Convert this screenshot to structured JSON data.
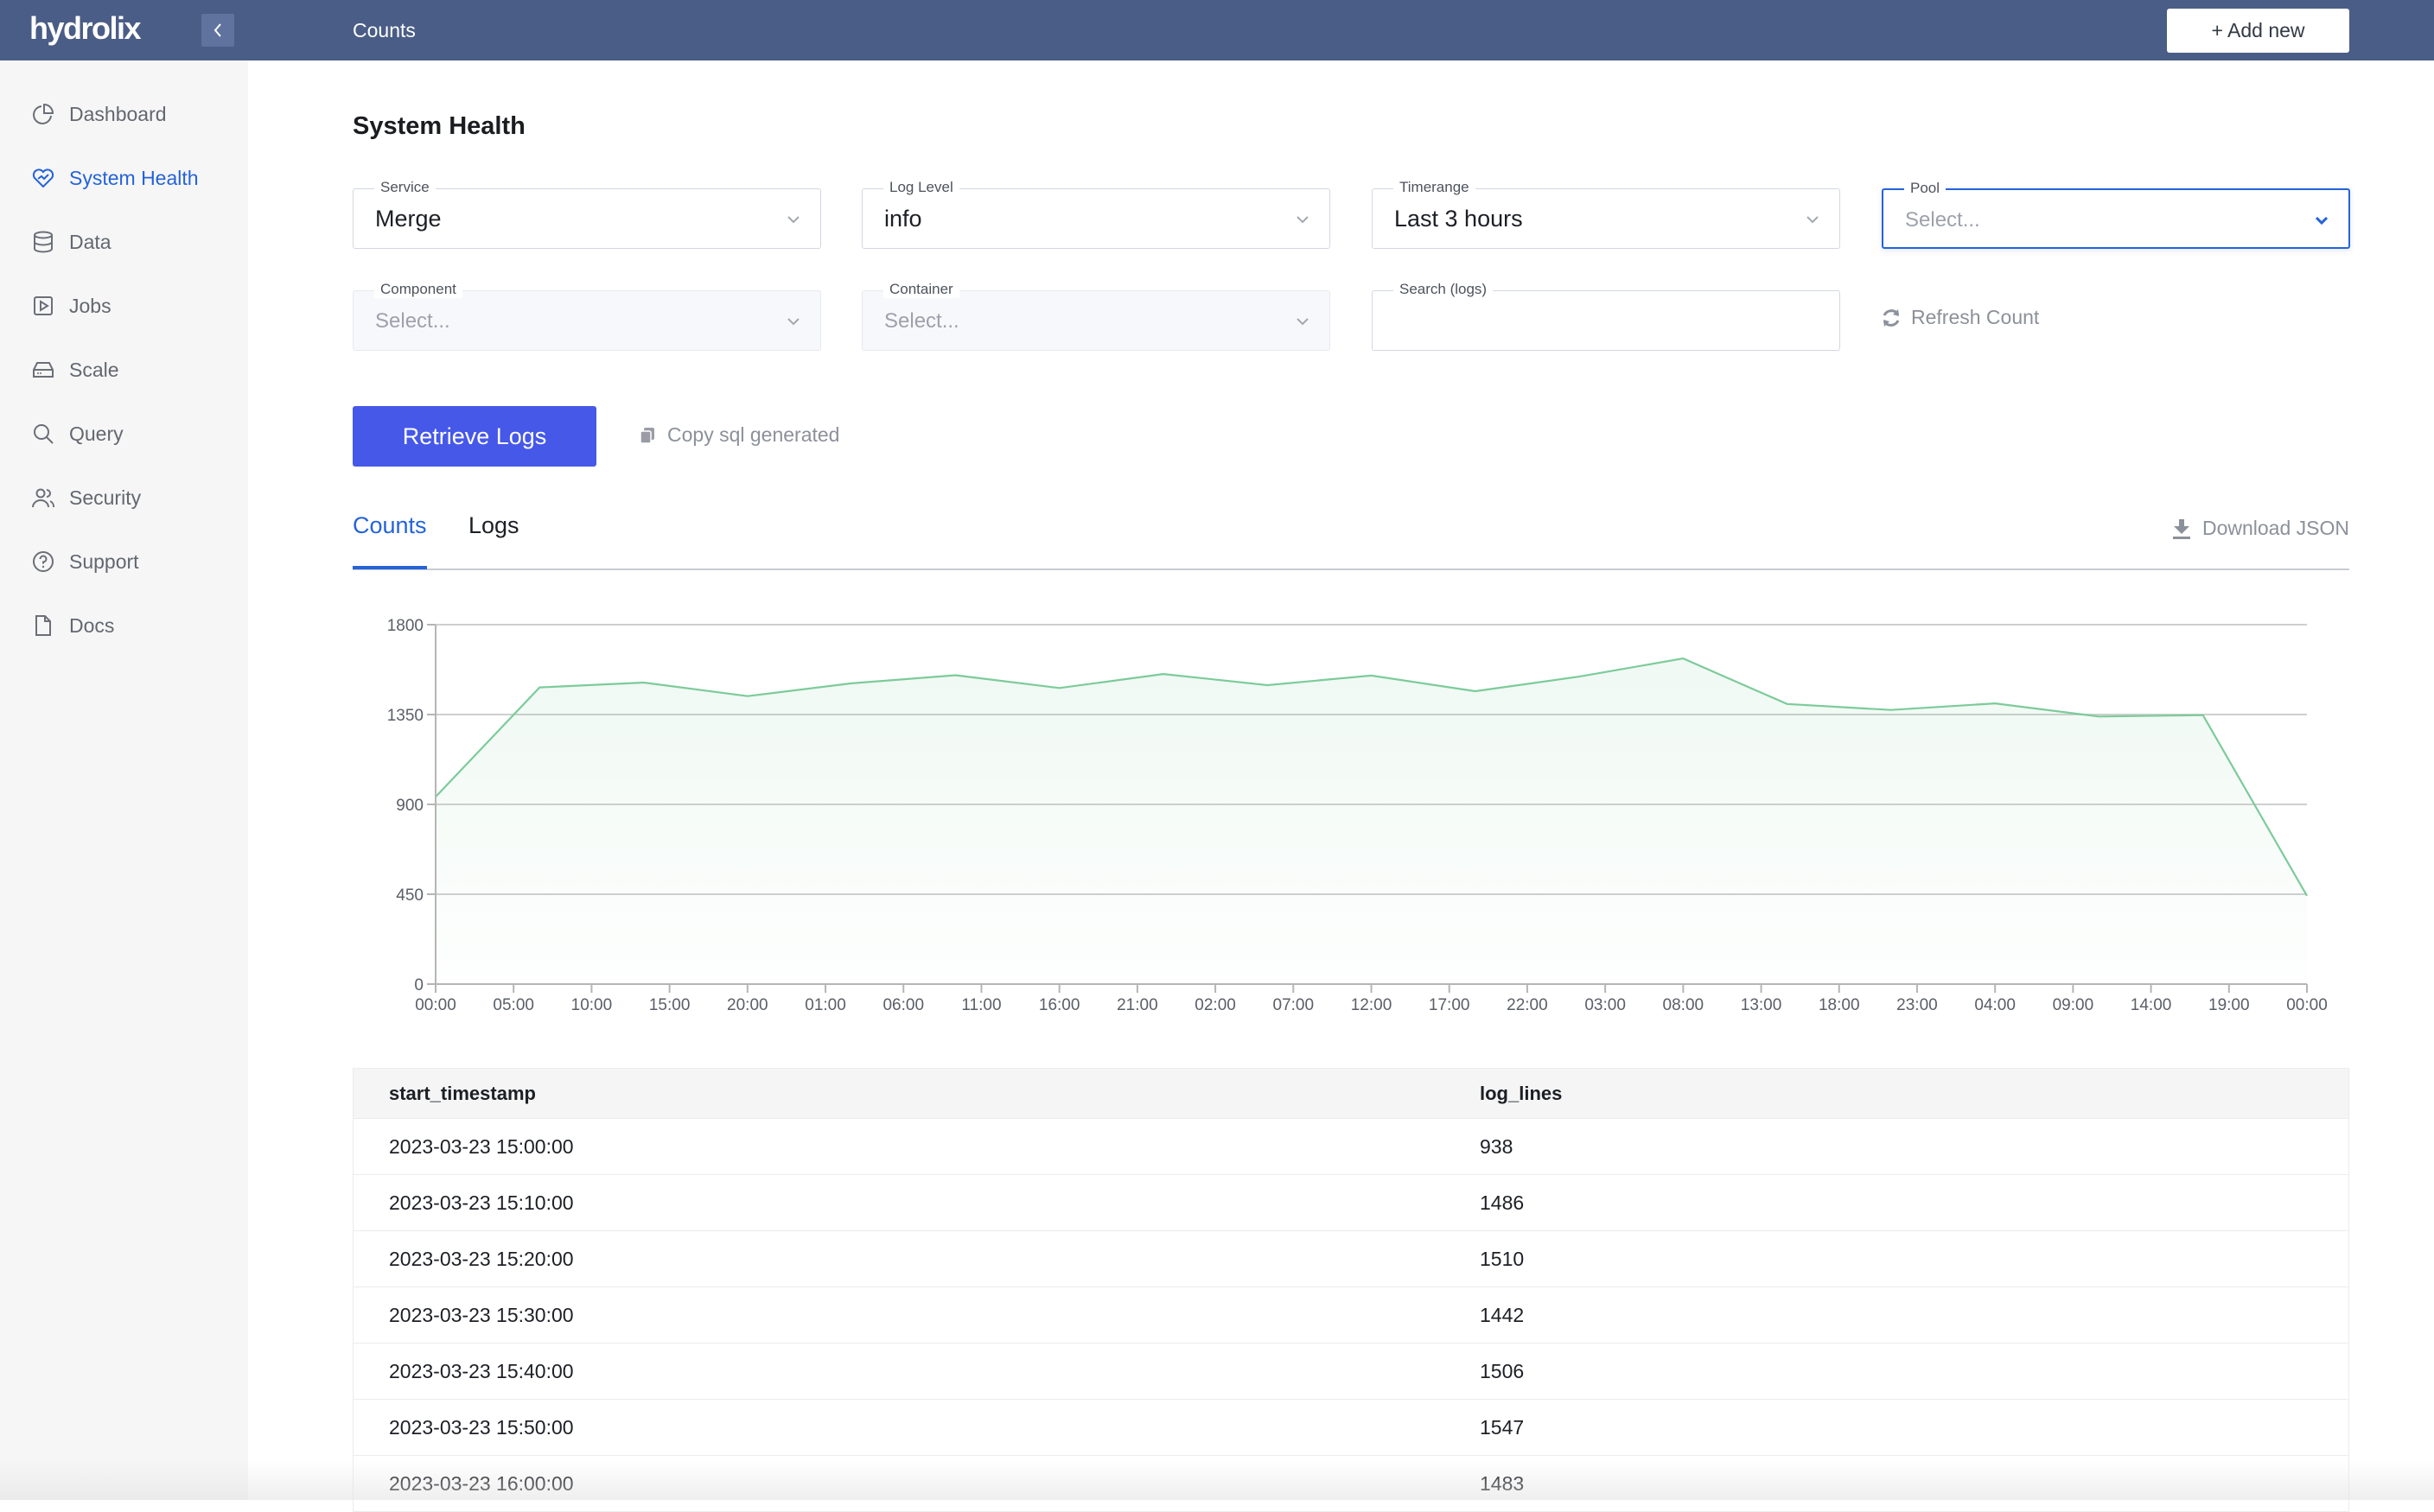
{
  "header": {
    "logo": "hydrolix",
    "title": "Counts",
    "add_new_label": "+ Add new",
    "collapse_icon": "chevron-left-icon"
  },
  "sidebar": {
    "items": [
      {
        "label": "Dashboard",
        "icon": "pie-chart-icon",
        "active": false
      },
      {
        "label": "System Health",
        "icon": "heart-pulse-icon",
        "active": true
      },
      {
        "label": "Data",
        "icon": "database-icon",
        "active": false
      },
      {
        "label": "Jobs",
        "icon": "play-box-icon",
        "active": false
      },
      {
        "label": "Scale",
        "icon": "server-drive-icon",
        "active": false
      },
      {
        "label": "Query",
        "icon": "search-icon",
        "active": false
      },
      {
        "label": "Security",
        "icon": "users-icon",
        "active": false
      },
      {
        "label": "Support",
        "icon": "help-circle-icon",
        "active": false
      },
      {
        "label": "Docs",
        "icon": "file-icon",
        "active": false
      }
    ]
  },
  "page": {
    "title": "System Health"
  },
  "filters": {
    "service": {
      "label": "Service",
      "value": "Merge"
    },
    "log_level": {
      "label": "Log Level",
      "value": "info"
    },
    "timerange": {
      "label": "Timerange",
      "value": "Last 3 hours"
    },
    "pool": {
      "label": "Pool",
      "placeholder": "Select..."
    },
    "component": {
      "label": "Component",
      "placeholder": "Select..."
    },
    "container": {
      "label": "Container",
      "placeholder": "Select..."
    },
    "search": {
      "label": "Search (logs)",
      "value": ""
    },
    "refresh_label": "Refresh Count"
  },
  "actions": {
    "retrieve_label": "Retrieve Logs",
    "copy_sql_label": "Copy sql generated"
  },
  "tabs": {
    "items": [
      {
        "label": "Counts",
        "active": true
      },
      {
        "label": "Logs",
        "active": false
      }
    ],
    "download_label": "Download JSON"
  },
  "colors": {
    "header_bg": "#4a5d86",
    "accent": "#2563d9",
    "primary_button": "#4658e8",
    "line": "#7ccb9a"
  },
  "chart_data": {
    "type": "area",
    "title": "",
    "xlabel": "",
    "ylabel": "",
    "ylim": [
      0,
      1800
    ],
    "yticks": [
      0,
      450,
      900,
      1350,
      1800
    ],
    "xtick_labels": [
      "00:00",
      "05:00",
      "10:00",
      "15:00",
      "20:00",
      "01:00",
      "06:00",
      "11:00",
      "16:00",
      "21:00",
      "02:00",
      "07:00",
      "12:00",
      "17:00",
      "22:00",
      "03:00",
      "08:00",
      "13:00",
      "18:00",
      "23:00",
      "04:00",
      "09:00",
      "14:00",
      "19:00",
      "00:00"
    ],
    "grid": true,
    "series": [
      {
        "name": "log_lines",
        "values": [
          938,
          1486,
          1510,
          1442,
          1506,
          1547,
          1483,
          1553,
          1497,
          1545,
          1467,
          1540,
          1631,
          1403,
          1373,
          1406,
          1340,
          1347,
          442
        ]
      }
    ]
  },
  "table": {
    "columns": [
      "start_timestamp",
      "log_lines"
    ],
    "rows": [
      [
        "2023-03-23 15:00:00",
        "938"
      ],
      [
        "2023-03-23 15:10:00",
        "1486"
      ],
      [
        "2023-03-23 15:20:00",
        "1510"
      ],
      [
        "2023-03-23 15:30:00",
        "1442"
      ],
      [
        "2023-03-23 15:40:00",
        "1506"
      ],
      [
        "2023-03-23 15:50:00",
        "1547"
      ],
      [
        "2023-03-23 16:00:00",
        "1483"
      ]
    ]
  }
}
